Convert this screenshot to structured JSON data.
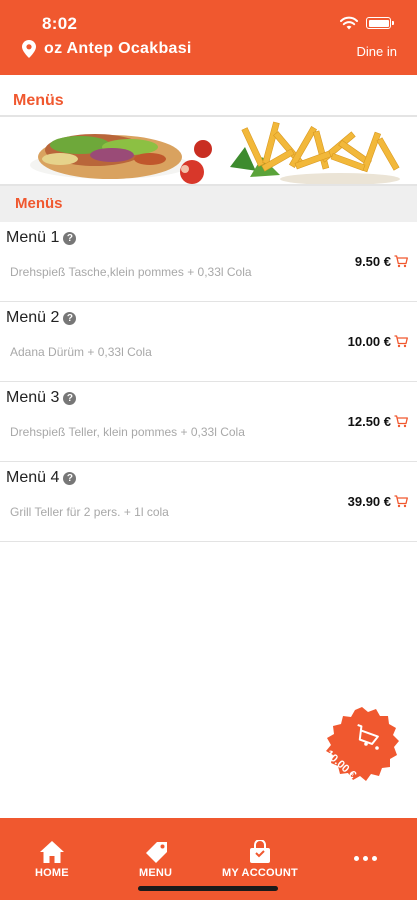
{
  "status_bar": {
    "time": "8:02"
  },
  "header": {
    "restaurant_name": "oz Antep Ocakbasi",
    "mode": "Dine in"
  },
  "page_title": "Menüs",
  "category": "Menüs",
  "menu_items": [
    {
      "name": "Menü 1",
      "description": "Drehspieß Tasche,klein pommes + 0,33l Cola",
      "price": "9.50 €"
    },
    {
      "name": "Menü 2",
      "description": "Adana Dürüm + 0,33l Cola",
      "price": "10.00 €"
    },
    {
      "name": "Menü 3",
      "description": "Drehspieß Teller, klein pommes + 0,33l Cola",
      "price": "12.50 €"
    },
    {
      "name": "Menü 4",
      "description": "Grill Teller für 2 pers. + 1l cola",
      "price": "39.90 €"
    }
  ],
  "cart": {
    "total": "10.00 €"
  },
  "nav": {
    "home": "HOME",
    "menu": "MENU",
    "account": "MY ACCOUNT"
  },
  "colors": {
    "accent": "#f0582f",
    "category_bg": "#efefef"
  },
  "icons": [
    "wifi-icon",
    "battery-icon",
    "location-pin-icon",
    "info-icon",
    "cart-icon",
    "home-icon",
    "tag-icon",
    "bag-icon",
    "more-icon"
  ]
}
